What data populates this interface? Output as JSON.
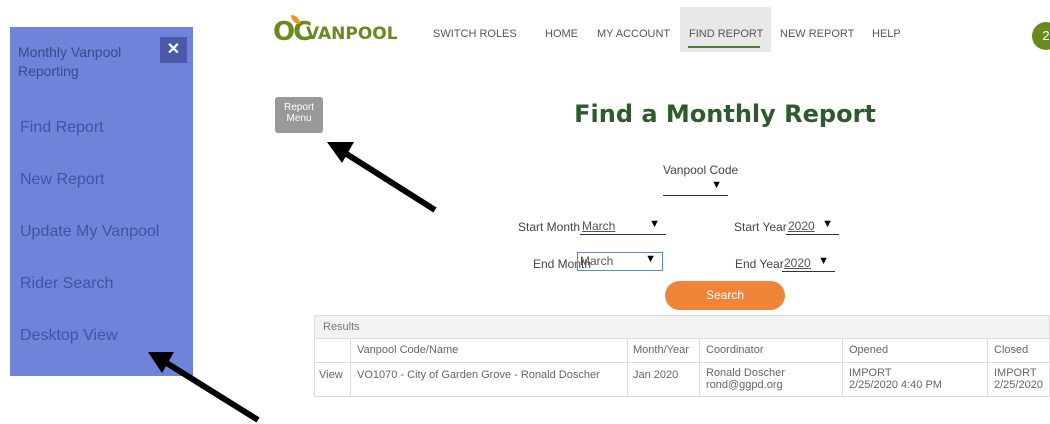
{
  "sidebar": {
    "title": "Monthly Vanpool Reporting",
    "close_label": "✕",
    "items": [
      {
        "label": "Find Report"
      },
      {
        "label": "New Report"
      },
      {
        "label": "Update My Vanpool"
      },
      {
        "label": "Rider Search"
      },
      {
        "label": "Desktop View"
      }
    ]
  },
  "header": {
    "logo_oc": "OC",
    "logo_text": "VANPOOL",
    "nav": [
      "SWITCH ROLES",
      "HOME",
      "MY ACCOUNT",
      "FIND REPORT",
      "NEW REPORT",
      "HELP"
    ],
    "active_nav": "FIND REPORT",
    "avatar_initial": "2"
  },
  "report_menu_label": "Report Menu",
  "page_title": "Find a Monthly Report",
  "form": {
    "vanpool_code_label": "Vanpool Code",
    "vanpool_code_value": "",
    "start_month_label": "Start Month",
    "start_month_value": "March",
    "start_year_label": "Start Year",
    "start_year_value": "2020",
    "end_month_label": "End Month",
    "end_month_value": "March",
    "end_year_label": "End Year",
    "end_year_value": "2020",
    "search_label": "Search",
    "arrow_glyph": "▼"
  },
  "results": {
    "header": "Results",
    "columns": [
      "Vanpool Code/Name",
      "Month/Year",
      "Coordinator",
      "Opened",
      "Closed"
    ],
    "rows": [
      {
        "action": "View",
        "vanpool": "VO1070 - City of Garden Grove - Ronald Doscher",
        "month_year": "Jan 2020",
        "coordinator_name": "Ronald Doscher",
        "coordinator_email": "rond@ggpd.org",
        "opened_status": "IMPORT",
        "opened_date": "2/25/2020 4:40 PM",
        "closed_status": "IMPORT",
        "closed_date": "2/25/2020"
      }
    ]
  },
  "colors": {
    "sidebar_bg": "#6f83db",
    "brand_green": "#6a8a1f",
    "title_green": "#2e5a2e",
    "search_orange": "#f0853a"
  }
}
